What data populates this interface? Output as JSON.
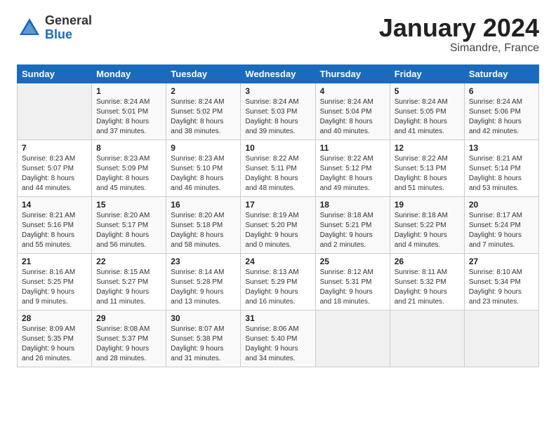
{
  "logo": {
    "general": "General",
    "blue": "Blue"
  },
  "title": "January 2024",
  "location": "Simandre, France",
  "headers": [
    "Sunday",
    "Monday",
    "Tuesday",
    "Wednesday",
    "Thursday",
    "Friday",
    "Saturday"
  ],
  "weeks": [
    [
      {
        "day": "",
        "sunrise": "",
        "sunset": "",
        "daylight": "",
        "empty": true
      },
      {
        "day": "1",
        "sunrise": "Sunrise: 8:24 AM",
        "sunset": "Sunset: 5:01 PM",
        "daylight": "Daylight: 8 hours and 37 minutes."
      },
      {
        "day": "2",
        "sunrise": "Sunrise: 8:24 AM",
        "sunset": "Sunset: 5:02 PM",
        "daylight": "Daylight: 8 hours and 38 minutes."
      },
      {
        "day": "3",
        "sunrise": "Sunrise: 8:24 AM",
        "sunset": "Sunset: 5:03 PM",
        "daylight": "Daylight: 8 hours and 39 minutes."
      },
      {
        "day": "4",
        "sunrise": "Sunrise: 8:24 AM",
        "sunset": "Sunset: 5:04 PM",
        "daylight": "Daylight: 8 hours and 40 minutes."
      },
      {
        "day": "5",
        "sunrise": "Sunrise: 8:24 AM",
        "sunset": "Sunset: 5:05 PM",
        "daylight": "Daylight: 8 hours and 41 minutes."
      },
      {
        "day": "6",
        "sunrise": "Sunrise: 8:24 AM",
        "sunset": "Sunset: 5:06 PM",
        "daylight": "Daylight: 8 hours and 42 minutes."
      }
    ],
    [
      {
        "day": "7",
        "sunrise": "Sunrise: 8:23 AM",
        "sunset": "Sunset: 5:07 PM",
        "daylight": "Daylight: 8 hours and 44 minutes."
      },
      {
        "day": "8",
        "sunrise": "Sunrise: 8:23 AM",
        "sunset": "Sunset: 5:09 PM",
        "daylight": "Daylight: 8 hours and 45 minutes."
      },
      {
        "day": "9",
        "sunrise": "Sunrise: 8:23 AM",
        "sunset": "Sunset: 5:10 PM",
        "daylight": "Daylight: 8 hours and 46 minutes."
      },
      {
        "day": "10",
        "sunrise": "Sunrise: 8:22 AM",
        "sunset": "Sunset: 5:11 PM",
        "daylight": "Daylight: 8 hours and 48 minutes."
      },
      {
        "day": "11",
        "sunrise": "Sunrise: 8:22 AM",
        "sunset": "Sunset: 5:12 PM",
        "daylight": "Daylight: 8 hours and 49 minutes."
      },
      {
        "day": "12",
        "sunrise": "Sunrise: 8:22 AM",
        "sunset": "Sunset: 5:13 PM",
        "daylight": "Daylight: 8 hours and 51 minutes."
      },
      {
        "day": "13",
        "sunrise": "Sunrise: 8:21 AM",
        "sunset": "Sunset: 5:14 PM",
        "daylight": "Daylight: 8 hours and 53 minutes."
      }
    ],
    [
      {
        "day": "14",
        "sunrise": "Sunrise: 8:21 AM",
        "sunset": "Sunset: 5:16 PM",
        "daylight": "Daylight: 8 hours and 55 minutes."
      },
      {
        "day": "15",
        "sunrise": "Sunrise: 8:20 AM",
        "sunset": "Sunset: 5:17 PM",
        "daylight": "Daylight: 8 hours and 56 minutes."
      },
      {
        "day": "16",
        "sunrise": "Sunrise: 8:20 AM",
        "sunset": "Sunset: 5:18 PM",
        "daylight": "Daylight: 8 hours and 58 minutes."
      },
      {
        "day": "17",
        "sunrise": "Sunrise: 8:19 AM",
        "sunset": "Sunset: 5:20 PM",
        "daylight": "Daylight: 9 hours and 0 minutes."
      },
      {
        "day": "18",
        "sunrise": "Sunrise: 8:18 AM",
        "sunset": "Sunset: 5:21 PM",
        "daylight": "Daylight: 9 hours and 2 minutes."
      },
      {
        "day": "19",
        "sunrise": "Sunrise: 8:18 AM",
        "sunset": "Sunset: 5:22 PM",
        "daylight": "Daylight: 9 hours and 4 minutes."
      },
      {
        "day": "20",
        "sunrise": "Sunrise: 8:17 AM",
        "sunset": "Sunset: 5:24 PM",
        "daylight": "Daylight: 9 hours and 7 minutes."
      }
    ],
    [
      {
        "day": "21",
        "sunrise": "Sunrise: 8:16 AM",
        "sunset": "Sunset: 5:25 PM",
        "daylight": "Daylight: 9 hours and 9 minutes."
      },
      {
        "day": "22",
        "sunrise": "Sunrise: 8:15 AM",
        "sunset": "Sunset: 5:27 PM",
        "daylight": "Daylight: 9 hours and 11 minutes."
      },
      {
        "day": "23",
        "sunrise": "Sunrise: 8:14 AM",
        "sunset": "Sunset: 5:28 PM",
        "daylight": "Daylight: 9 hours and 13 minutes."
      },
      {
        "day": "24",
        "sunrise": "Sunrise: 8:13 AM",
        "sunset": "Sunset: 5:29 PM",
        "daylight": "Daylight: 9 hours and 16 minutes."
      },
      {
        "day": "25",
        "sunrise": "Sunrise: 8:12 AM",
        "sunset": "Sunset: 5:31 PM",
        "daylight": "Daylight: 9 hours and 18 minutes."
      },
      {
        "day": "26",
        "sunrise": "Sunrise: 8:11 AM",
        "sunset": "Sunset: 5:32 PM",
        "daylight": "Daylight: 9 hours and 21 minutes."
      },
      {
        "day": "27",
        "sunrise": "Sunrise: 8:10 AM",
        "sunset": "Sunset: 5:34 PM",
        "daylight": "Daylight: 9 hours and 23 minutes."
      }
    ],
    [
      {
        "day": "28",
        "sunrise": "Sunrise: 8:09 AM",
        "sunset": "Sunset: 5:35 PM",
        "daylight": "Daylight: 9 hours and 26 minutes."
      },
      {
        "day": "29",
        "sunrise": "Sunrise: 8:08 AM",
        "sunset": "Sunset: 5:37 PM",
        "daylight": "Daylight: 9 hours and 28 minutes."
      },
      {
        "day": "30",
        "sunrise": "Sunrise: 8:07 AM",
        "sunset": "Sunset: 5:38 PM",
        "daylight": "Daylight: 9 hours and 31 minutes."
      },
      {
        "day": "31",
        "sunrise": "Sunrise: 8:06 AM",
        "sunset": "Sunset: 5:40 PM",
        "daylight": "Daylight: 9 hours and 34 minutes."
      },
      {
        "day": "",
        "sunrise": "",
        "sunset": "",
        "daylight": "",
        "empty": true
      },
      {
        "day": "",
        "sunrise": "",
        "sunset": "",
        "daylight": "",
        "empty": true
      },
      {
        "day": "",
        "sunrise": "",
        "sunset": "",
        "daylight": "",
        "empty": true
      }
    ]
  ]
}
